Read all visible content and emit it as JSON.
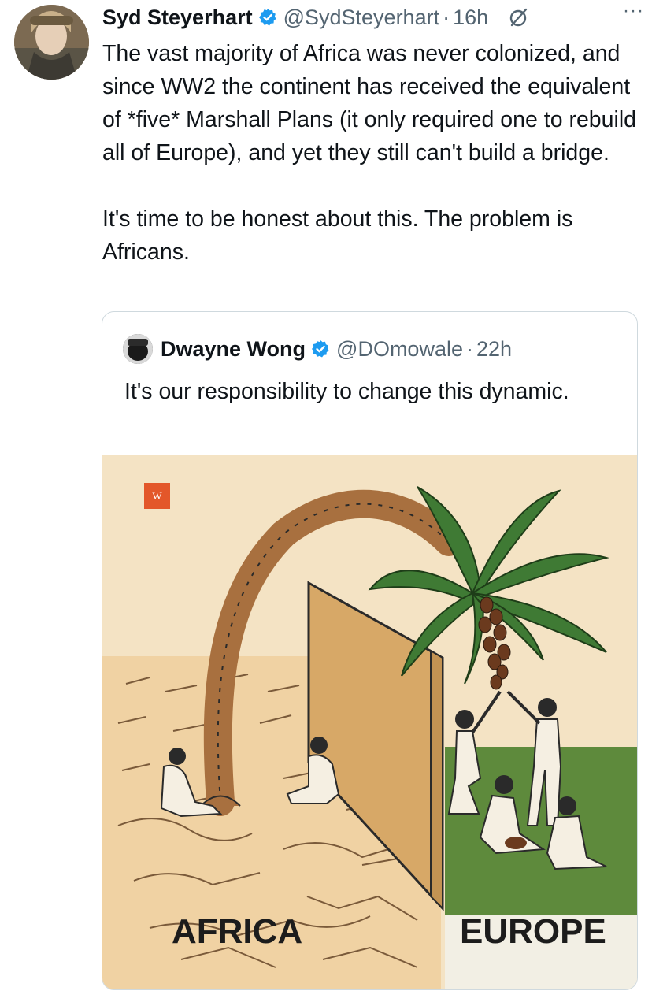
{
  "tweet": {
    "author_name": "Syd Steyerhart",
    "handle": "@SydSteyerhart",
    "separator": "·",
    "time": "16h",
    "more_label": "···",
    "paragraphs": [
      "The vast majority of Africa was never colonized, and since WW2 the continent has received the equivalent of *five* Marshall Plans (it only required one to rebuild all of Europe), and yet they still can't build a bridge.",
      "It's time to be honest about this. The problem is Africans."
    ]
  },
  "quote": {
    "author_name": "Dwayne Wong",
    "handle": "@DOmowale",
    "separator": "·",
    "time": "22h",
    "text": "It's our responsibility to change this dynamic.",
    "image": {
      "badge": "W",
      "left_label": "AFRICA",
      "right_label": "EUROPE"
    }
  },
  "colors": {
    "verified": "#1d9bf0",
    "secondary_text": "#536471",
    "desert": "#f1d7ac",
    "grass": "#5e8a3c",
    "wall": "#d7a867"
  },
  "icons": [
    "verified-badge-icon",
    "grok-icon",
    "more-icon"
  ]
}
